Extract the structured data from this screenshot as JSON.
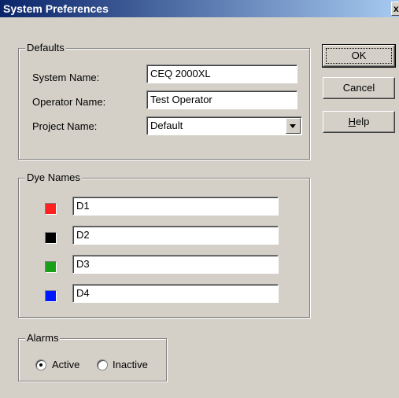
{
  "window": {
    "title": "System Preferences",
    "close_glyph": "x"
  },
  "defaults": {
    "legend": "Defaults",
    "system_name": {
      "label": "System Name:",
      "value": "CEQ 2000XL"
    },
    "operator_name": {
      "label": "Operator Name:",
      "value": "Test Operator"
    },
    "project_name": {
      "label": "Project Name:",
      "value": "Default"
    }
  },
  "dye_names": {
    "legend": "Dye Names",
    "items": [
      {
        "value": "D1",
        "color": "#ff2020"
      },
      {
        "value": "D2",
        "color": "#000000"
      },
      {
        "value": "D3",
        "color": "#18a018"
      },
      {
        "value": "D4",
        "color": "#0018ff"
      }
    ]
  },
  "alarms": {
    "legend": "Alarms",
    "options": [
      {
        "label": "Active",
        "selected": true
      },
      {
        "label": "Inactive",
        "selected": false
      }
    ]
  },
  "buttons": {
    "ok": "OK",
    "cancel": "Cancel",
    "help_prefix": "H",
    "help_rest": "elp"
  }
}
